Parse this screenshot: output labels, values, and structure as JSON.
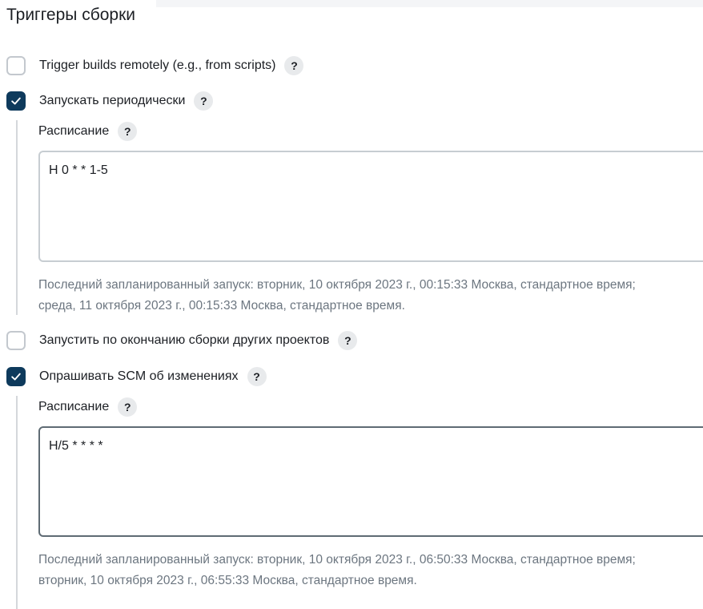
{
  "section": {
    "title": "Триггеры сборки"
  },
  "triggers": [
    {
      "label": "Trigger builds remotely (e.g., from scripts)",
      "checked": false,
      "help": "?"
    },
    {
      "label": "Запускать периодически",
      "checked": true,
      "help": "?",
      "schedule_label": "Расписание",
      "schedule_value": "H 0 * * 1-5",
      "info_line1": "Последний запланированный запуск: вторник, 10 октября 2023 г., 00:15:33 Москва, стандартное время;",
      "info_line2": "среда, 11 октября 2023 г., 00:15:33 Москва, стандартное время."
    },
    {
      "label": "Запустить по окончанию сборки других проектов",
      "checked": false,
      "help": "?"
    },
    {
      "label": "Опрашивать SCM об изменениях",
      "checked": true,
      "help": "?",
      "schedule_label": "Расписание",
      "schedule_value": "H/5 * * * *",
      "info_line1": "Последний запланированный запуск: вторник, 10 октября 2023 г., 06:50:33 Москва, стандартное время;",
      "info_line2": "вторник, 10 октября 2023 г., 06:55:33 Москва, стандартное время."
    }
  ],
  "colors": {
    "checkbox_checked": "#0e3a5c",
    "checkbox_border": "#c3c8ce",
    "help_bg": "#e8eaec",
    "info_text": "#6c7680"
  },
  "icons": {
    "check": "checkmark-icon",
    "help": "question-mark-icon"
  }
}
